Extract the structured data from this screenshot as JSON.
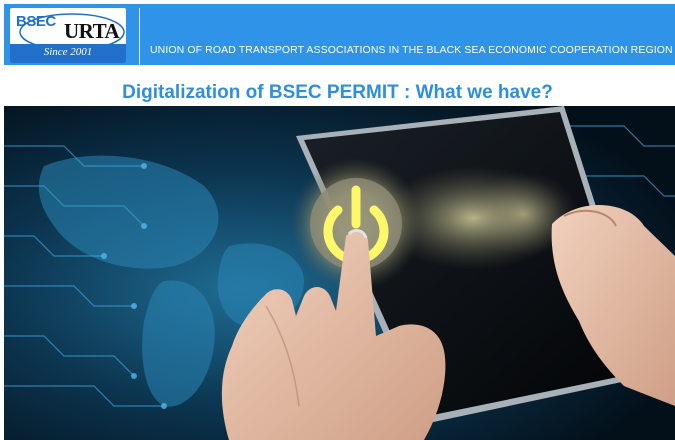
{
  "header": {
    "logo_bsec": "BSEC",
    "logo_urta": "URTA",
    "logo_since": "Since 2001",
    "organization": "UNION OF ROAD TRANSPORT ASSOCIATIONS IN THE BLACK SEA ECONOMIC COOPERATION REGION"
  },
  "slide": {
    "title": "Digitalization of BSEC PERMIT : What we have?"
  },
  "colors": {
    "header_bg": "#2f93e8",
    "title_text": "#2f8fdc",
    "photo_bg": "#061522",
    "power_glow": "#f2ef6a"
  },
  "icons": {
    "power": "power-icon"
  }
}
